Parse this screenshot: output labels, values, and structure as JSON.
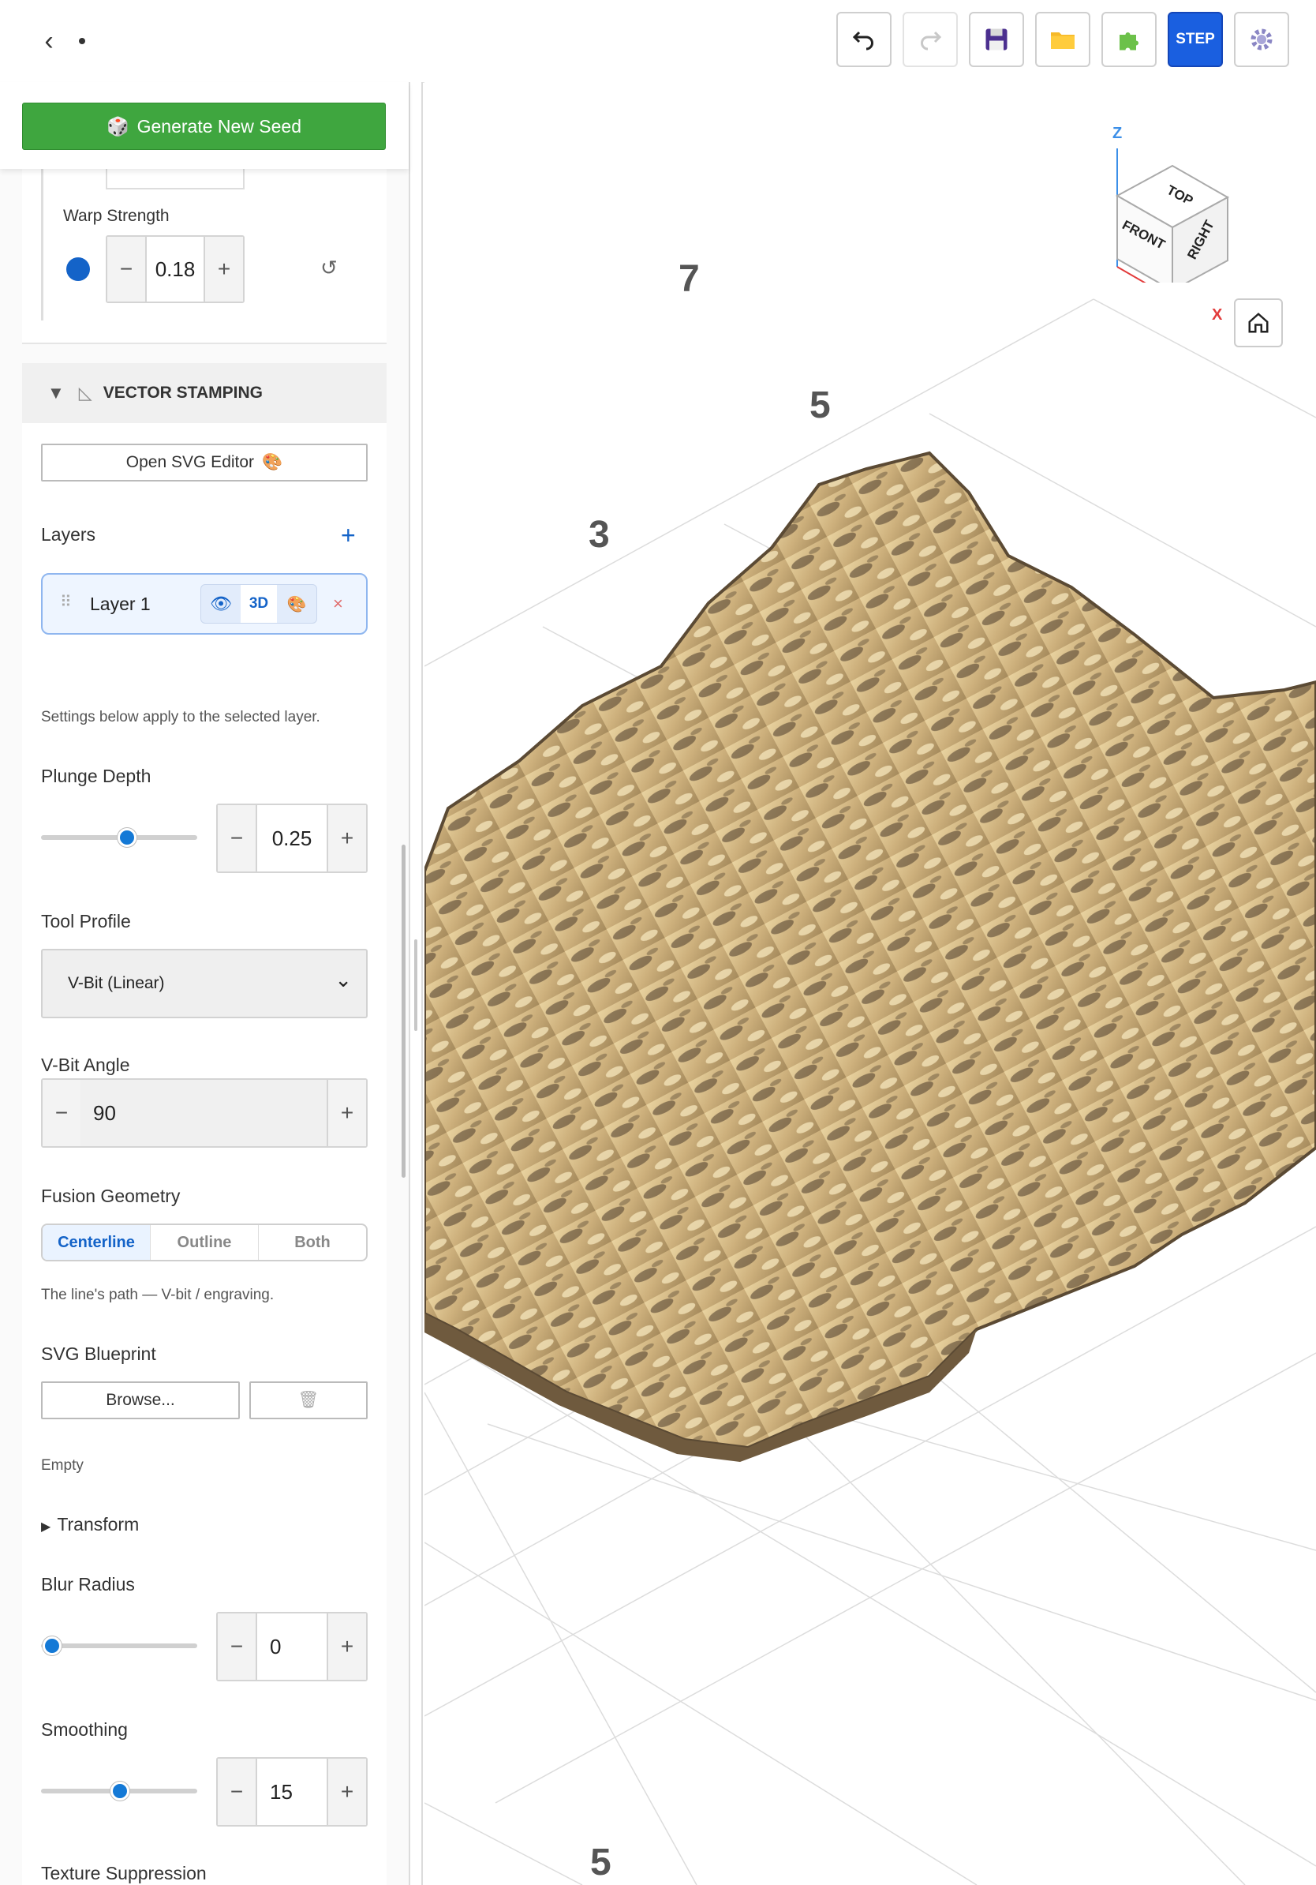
{
  "toolbar": {
    "back_icon": "chevron-left-icon",
    "undo_icon": "undo-icon",
    "redo_icon": "redo-icon",
    "save_icon": "floppy-disk-icon",
    "open_icon": "folder-icon",
    "plugin_icon": "puzzle-icon",
    "step_label": "STEP",
    "settings_icon": "gear-icon"
  },
  "sidebar": {
    "generate_label": "Generate New Seed",
    "warp": {
      "label": "Warp Strength",
      "value": "0.18",
      "minus": "−",
      "plus": "+",
      "reset": "↺"
    },
    "vector_stamping": {
      "title": "VECTOR STAMPING",
      "open_svg_label": "Open SVG Editor",
      "layers_label": "Layers",
      "add_layer": "+",
      "layer_name": "Layer 1",
      "layer_3d": "3D",
      "layer_remove": "×",
      "hint": "Settings below apply to the selected layer.",
      "plunge": {
        "label": "Plunge Depth",
        "value": "0.25",
        "slider_fraction": 0.55
      },
      "tool_profile": {
        "label": "Tool Profile",
        "value": "V-Bit (Linear)"
      },
      "vbit_angle": {
        "label": "V-Bit Angle",
        "value": "90"
      },
      "fusion": {
        "label": "Fusion Geometry",
        "options": [
          "Centerline",
          "Outline",
          "Both"
        ],
        "selected": "Centerline",
        "note": "The line's path — V-bit / engraving."
      },
      "blueprint": {
        "label": "SVG Blueprint",
        "browse": "Browse...",
        "status": "Empty"
      },
      "transform_label": "Transform",
      "blur": {
        "label": "Blur Radius",
        "value": "0",
        "slider_fraction": 0.07
      },
      "smoothing": {
        "label": "Smoothing",
        "value": "15",
        "slider_fraction": 0.5
      },
      "texture_label": "Texture Suppression"
    }
  },
  "viewport": {
    "grid_labels": [
      "7",
      "5",
      "3",
      "5"
    ],
    "axis_z": "Z",
    "axis_x": "X",
    "cube_faces": {
      "top": "TOP",
      "front": "FRONT",
      "right": "RIGHT"
    },
    "terrain_color": "#d8bf8e"
  },
  "colors": {
    "accent": "#1479d6",
    "generate": "#3fa63f",
    "step": "#1a5fe0"
  }
}
